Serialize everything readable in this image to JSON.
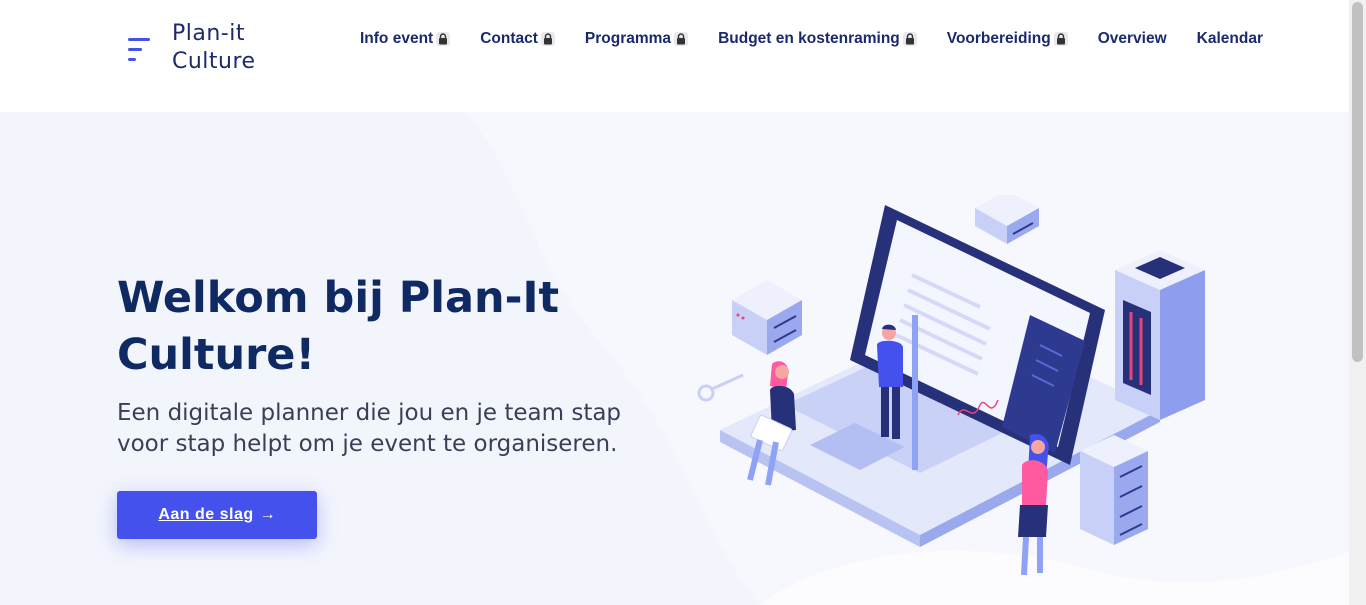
{
  "brand": {
    "line1": "Plan-it",
    "line2": "Culture",
    "accent_color": "#4253e6",
    "icon": "menu-lines-icon"
  },
  "nav": {
    "items": [
      {
        "label": "Info event",
        "locked": true
      },
      {
        "label": "Contact",
        "locked": true
      },
      {
        "label": "Programma",
        "locked": true
      },
      {
        "label": "Budget en kostenraming",
        "locked": true
      },
      {
        "label": "Voorbereiding",
        "locked": true
      },
      {
        "label": "Overview",
        "locked": false
      },
      {
        "label": "Kalendar",
        "locked": false
      }
    ],
    "lock_icon": "lock-icon",
    "text_color": "#1a2a6c"
  },
  "hero": {
    "title": "Welkom bij Plan-It Culture!",
    "subtitle": "Een digitale planner die jou en je team stap voor stap helpt om je event te organiseren.",
    "cta_label": "Aan de slag",
    "cta_arrow": "→",
    "background": "#f3f5fd",
    "title_color": "#0f2a63",
    "button_color": "#4451ec",
    "illustration": "isometric-laptop-team-illustration"
  }
}
